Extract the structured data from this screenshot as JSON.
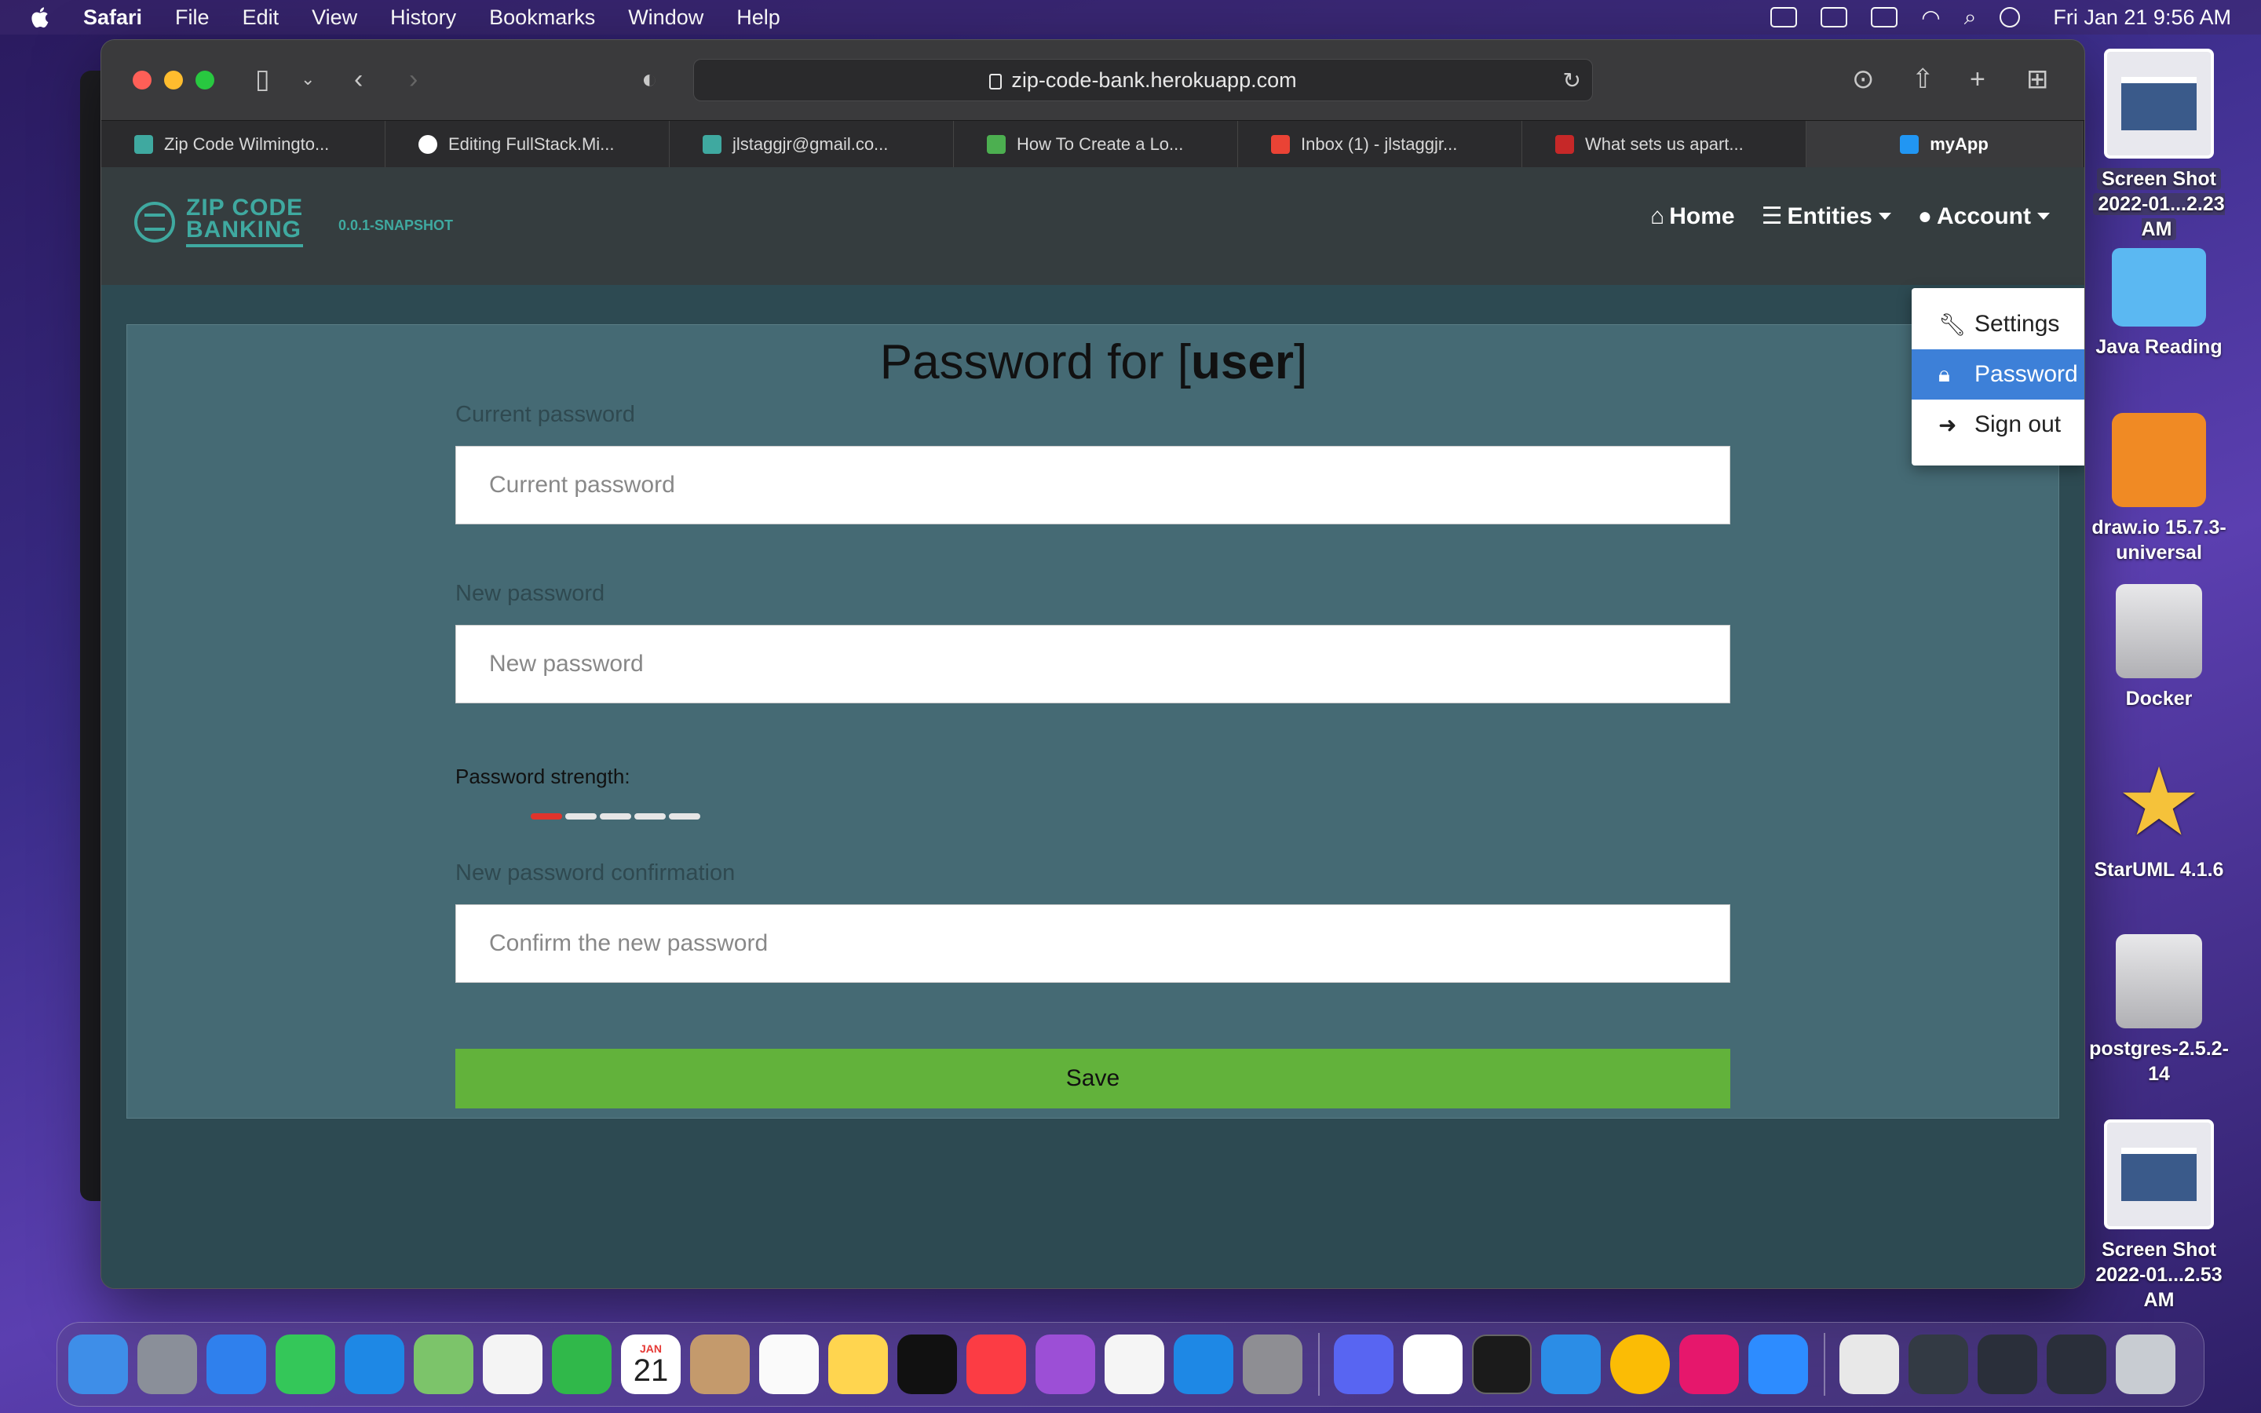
{
  "menubar": {
    "app_name": "Safari",
    "items": [
      "File",
      "Edit",
      "View",
      "History",
      "Bookmarks",
      "Window",
      "Help"
    ],
    "datetime": "Fri Jan 21  9:56 AM"
  },
  "browser": {
    "url": "zip-code-bank.herokuapp.com",
    "tabs": [
      {
        "label": "Zip Code Wilmingto...",
        "favicon_color": "#3fa9a0"
      },
      {
        "label": "Editing FullStack.Mi...",
        "favicon_color": "#ffffff"
      },
      {
        "label": "jlstaggjr@gmail.co...",
        "favicon_color": "#3fa9a0"
      },
      {
        "label": "How To Create a Lo...",
        "favicon_color": "#4caf50"
      },
      {
        "label": "Inbox (1) - jlstaggjr...",
        "favicon_color": "#ea4335"
      },
      {
        "label": "What sets us apart...",
        "favicon_color": "#c62828"
      },
      {
        "label": "myApp",
        "favicon_color": "#2196f3"
      }
    ]
  },
  "app": {
    "brand_line1": "ZIP CODE",
    "brand_line2": "BANKING",
    "version": "0.0.1-SNAPSHOT",
    "nav": {
      "home": "Home",
      "entities": "Entities",
      "account": "Account"
    },
    "account_menu": {
      "settings": "Settings",
      "password": "Password",
      "sign_out": "Sign out"
    },
    "form": {
      "title_prefix": "Password for [",
      "title_user": "user",
      "title_suffix": "]",
      "current_label": "Current password",
      "current_placeholder": "Current password",
      "new_label": "New password",
      "new_placeholder": "New password",
      "strength_label": "Password strength:",
      "strength_level": 0.2,
      "confirm_label": "New password confirmation",
      "confirm_placeholder": "Confirm the new password",
      "save": "Save"
    }
  },
  "desktop": {
    "items": [
      {
        "label1": "Screen Shot",
        "label2": "2022-01...2.23 AM"
      },
      {
        "label1": "Java Reading",
        "label2": ""
      },
      {
        "label1": "draw.io 15.7.3-",
        "label2": "universal"
      },
      {
        "label1": "Docker",
        "label2": ""
      },
      {
        "label1": "StarUML 4.1.6",
        "label2": ""
      },
      {
        "label1": "postgres-2.5.2-14",
        "label2": ""
      },
      {
        "label1": "Screen Shot",
        "label2": "2022-01...2.53 AM"
      }
    ]
  },
  "dock": {
    "calendar_month": "JAN",
    "calendar_day": "21"
  }
}
